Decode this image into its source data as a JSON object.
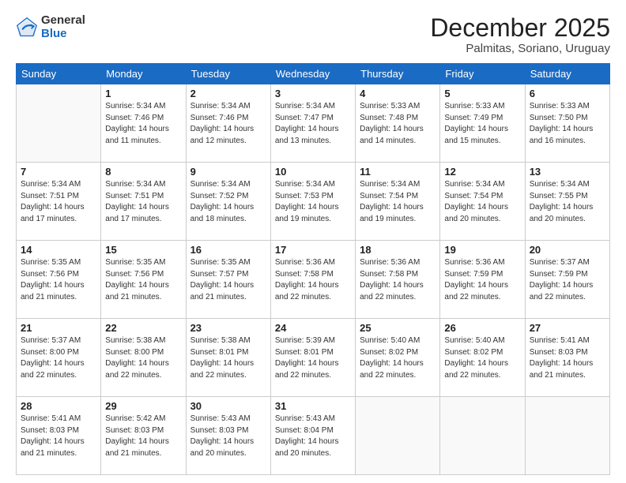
{
  "logo": {
    "general": "General",
    "blue": "Blue"
  },
  "header": {
    "month": "December 2025",
    "location": "Palmitas, Soriano, Uruguay"
  },
  "weekdays": [
    "Sunday",
    "Monday",
    "Tuesday",
    "Wednesday",
    "Thursday",
    "Friday",
    "Saturday"
  ],
  "weeks": [
    [
      {
        "day": "",
        "sunrise": "",
        "sunset": "",
        "daylight": ""
      },
      {
        "day": "1",
        "sunrise": "Sunrise: 5:34 AM",
        "sunset": "Sunset: 7:46 PM",
        "daylight": "Daylight: 14 hours and 11 minutes."
      },
      {
        "day": "2",
        "sunrise": "Sunrise: 5:34 AM",
        "sunset": "Sunset: 7:46 PM",
        "daylight": "Daylight: 14 hours and 12 minutes."
      },
      {
        "day": "3",
        "sunrise": "Sunrise: 5:34 AM",
        "sunset": "Sunset: 7:47 PM",
        "daylight": "Daylight: 14 hours and 13 minutes."
      },
      {
        "day": "4",
        "sunrise": "Sunrise: 5:33 AM",
        "sunset": "Sunset: 7:48 PM",
        "daylight": "Daylight: 14 hours and 14 minutes."
      },
      {
        "day": "5",
        "sunrise": "Sunrise: 5:33 AM",
        "sunset": "Sunset: 7:49 PM",
        "daylight": "Daylight: 14 hours and 15 minutes."
      },
      {
        "day": "6",
        "sunrise": "Sunrise: 5:33 AM",
        "sunset": "Sunset: 7:50 PM",
        "daylight": "Daylight: 14 hours and 16 minutes."
      }
    ],
    [
      {
        "day": "7",
        "sunrise": "Sunrise: 5:34 AM",
        "sunset": "Sunset: 7:51 PM",
        "daylight": "Daylight: 14 hours and 17 minutes."
      },
      {
        "day": "8",
        "sunrise": "Sunrise: 5:34 AM",
        "sunset": "Sunset: 7:51 PM",
        "daylight": "Daylight: 14 hours and 17 minutes."
      },
      {
        "day": "9",
        "sunrise": "Sunrise: 5:34 AM",
        "sunset": "Sunset: 7:52 PM",
        "daylight": "Daylight: 14 hours and 18 minutes."
      },
      {
        "day": "10",
        "sunrise": "Sunrise: 5:34 AM",
        "sunset": "Sunset: 7:53 PM",
        "daylight": "Daylight: 14 hours and 19 minutes."
      },
      {
        "day": "11",
        "sunrise": "Sunrise: 5:34 AM",
        "sunset": "Sunset: 7:54 PM",
        "daylight": "Daylight: 14 hours and 19 minutes."
      },
      {
        "day": "12",
        "sunrise": "Sunrise: 5:34 AM",
        "sunset": "Sunset: 7:54 PM",
        "daylight": "Daylight: 14 hours and 20 minutes."
      },
      {
        "day": "13",
        "sunrise": "Sunrise: 5:34 AM",
        "sunset": "Sunset: 7:55 PM",
        "daylight": "Daylight: 14 hours and 20 minutes."
      }
    ],
    [
      {
        "day": "14",
        "sunrise": "Sunrise: 5:35 AM",
        "sunset": "Sunset: 7:56 PM",
        "daylight": "Daylight: 14 hours and 21 minutes."
      },
      {
        "day": "15",
        "sunrise": "Sunrise: 5:35 AM",
        "sunset": "Sunset: 7:56 PM",
        "daylight": "Daylight: 14 hours and 21 minutes."
      },
      {
        "day": "16",
        "sunrise": "Sunrise: 5:35 AM",
        "sunset": "Sunset: 7:57 PM",
        "daylight": "Daylight: 14 hours and 21 minutes."
      },
      {
        "day": "17",
        "sunrise": "Sunrise: 5:36 AM",
        "sunset": "Sunset: 7:58 PM",
        "daylight": "Daylight: 14 hours and 22 minutes."
      },
      {
        "day": "18",
        "sunrise": "Sunrise: 5:36 AM",
        "sunset": "Sunset: 7:58 PM",
        "daylight": "Daylight: 14 hours and 22 minutes."
      },
      {
        "day": "19",
        "sunrise": "Sunrise: 5:36 AM",
        "sunset": "Sunset: 7:59 PM",
        "daylight": "Daylight: 14 hours and 22 minutes."
      },
      {
        "day": "20",
        "sunrise": "Sunrise: 5:37 AM",
        "sunset": "Sunset: 7:59 PM",
        "daylight": "Daylight: 14 hours and 22 minutes."
      }
    ],
    [
      {
        "day": "21",
        "sunrise": "Sunrise: 5:37 AM",
        "sunset": "Sunset: 8:00 PM",
        "daylight": "Daylight: 14 hours and 22 minutes."
      },
      {
        "day": "22",
        "sunrise": "Sunrise: 5:38 AM",
        "sunset": "Sunset: 8:00 PM",
        "daylight": "Daylight: 14 hours and 22 minutes."
      },
      {
        "day": "23",
        "sunrise": "Sunrise: 5:38 AM",
        "sunset": "Sunset: 8:01 PM",
        "daylight": "Daylight: 14 hours and 22 minutes."
      },
      {
        "day": "24",
        "sunrise": "Sunrise: 5:39 AM",
        "sunset": "Sunset: 8:01 PM",
        "daylight": "Daylight: 14 hours and 22 minutes."
      },
      {
        "day": "25",
        "sunrise": "Sunrise: 5:40 AM",
        "sunset": "Sunset: 8:02 PM",
        "daylight": "Daylight: 14 hours and 22 minutes."
      },
      {
        "day": "26",
        "sunrise": "Sunrise: 5:40 AM",
        "sunset": "Sunset: 8:02 PM",
        "daylight": "Daylight: 14 hours and 22 minutes."
      },
      {
        "day": "27",
        "sunrise": "Sunrise: 5:41 AM",
        "sunset": "Sunset: 8:03 PM",
        "daylight": "Daylight: 14 hours and 21 minutes."
      }
    ],
    [
      {
        "day": "28",
        "sunrise": "Sunrise: 5:41 AM",
        "sunset": "Sunset: 8:03 PM",
        "daylight": "Daylight: 14 hours and 21 minutes."
      },
      {
        "day": "29",
        "sunrise": "Sunrise: 5:42 AM",
        "sunset": "Sunset: 8:03 PM",
        "daylight": "Daylight: 14 hours and 21 minutes."
      },
      {
        "day": "30",
        "sunrise": "Sunrise: 5:43 AM",
        "sunset": "Sunset: 8:03 PM",
        "daylight": "Daylight: 14 hours and 20 minutes."
      },
      {
        "day": "31",
        "sunrise": "Sunrise: 5:43 AM",
        "sunset": "Sunset: 8:04 PM",
        "daylight": "Daylight: 14 hours and 20 minutes."
      },
      {
        "day": "",
        "sunrise": "",
        "sunset": "",
        "daylight": ""
      },
      {
        "day": "",
        "sunrise": "",
        "sunset": "",
        "daylight": ""
      },
      {
        "day": "",
        "sunrise": "",
        "sunset": "",
        "daylight": ""
      }
    ]
  ]
}
